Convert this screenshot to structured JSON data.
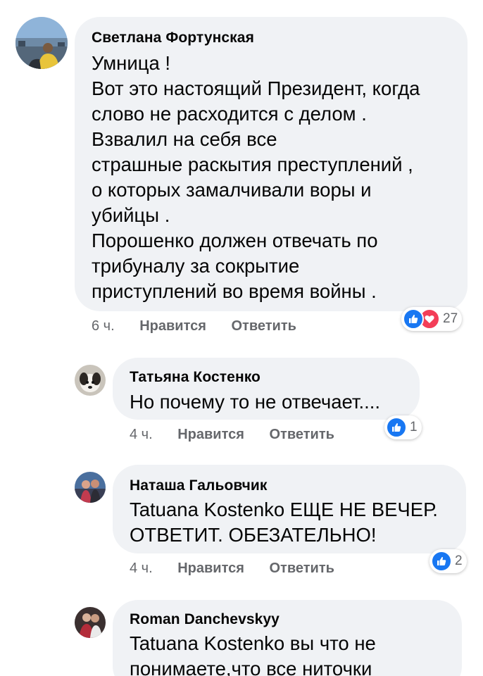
{
  "comments": [
    {
      "author": "Светлана Фортунская",
      "lines": [
        "Умница !",
        "Вот это настоящий Президент, когда",
        "слово не расходится с делом .",
        "Взвалил на себя все",
        "страшные раскытия преступлений ,",
        "о которых замалчивали воры и",
        "убийцы .",
        "Порошенко должен отвечать по",
        "трибуналу за сокрытие",
        "приступлений во время войны ."
      ],
      "time": "6 ч.",
      "like_label": "Нравится",
      "reply_label": "Ответить",
      "reaction_count": "27",
      "reactions": [
        "like",
        "love"
      ]
    },
    {
      "author": "Татьяна Костенко",
      "lines": [
        "Но почему то не отвечает...."
      ],
      "time": "4 ч.",
      "like_label": "Нравится",
      "reply_label": "Ответить",
      "reaction_count": "1",
      "reactions": [
        "like"
      ]
    },
    {
      "author": "Наташа Гальовчик",
      "lines": [
        "Tatuana Kostenko ЕЩЕ НЕ ВЕЧЕР.",
        "ОТВЕТИТ. ОБЕЗАТЕЛЬНО!"
      ],
      "time": "4 ч.",
      "like_label": "Нравится",
      "reply_label": "Ответить",
      "reaction_count": "2",
      "reactions": [
        "like"
      ]
    },
    {
      "author": "Roman Danchevskyy",
      "lines": [
        "Tatuana Kostenko вы что не",
        "понимаете,что все ниточки"
      ]
    }
  ],
  "colors": {
    "bubble": "#f0f2f5",
    "secondary_text": "#65676b",
    "like_blue": "#1877f2",
    "love_red": "#f33e58"
  },
  "icons": [
    "thumbs-up-icon",
    "heart-icon"
  ]
}
